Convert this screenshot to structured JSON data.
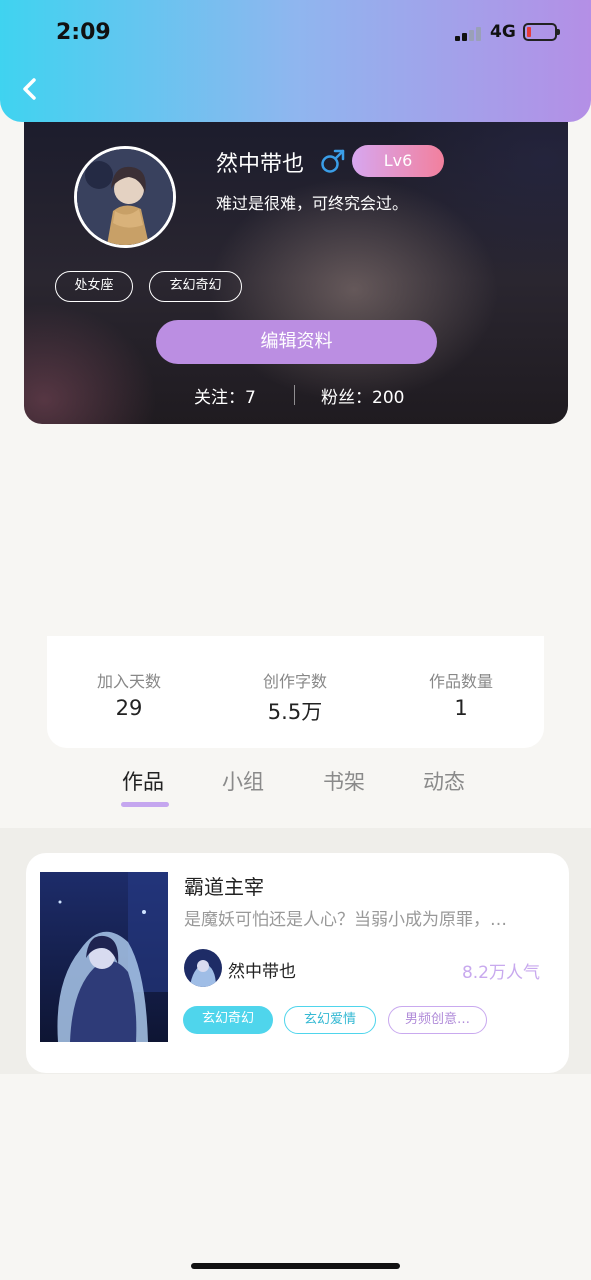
{
  "status_bar": {
    "time": "2:09",
    "network": "4G"
  },
  "profile": {
    "username": "然中带也",
    "level": "Lv6",
    "signature": "难过是很难，可终究会过。",
    "tags": [
      "处女座",
      "玄幻奇幻"
    ],
    "edit_label": "编辑资料",
    "following": "关注：7",
    "followers": "粉丝：200"
  },
  "stats": [
    {
      "label": "加入天数",
      "value": "29"
    },
    {
      "label": "创作字数",
      "value": "5.5万"
    },
    {
      "label": "作品数量",
      "value": "1"
    }
  ],
  "tabs": [
    "作品",
    "小组",
    "书架",
    "动态"
  ],
  "active_tab": "作品",
  "work": {
    "title": "霸道主宰",
    "description": "是魔妖可怕还是人心？当弱小成为原罪，…",
    "author": "然中带也",
    "popularity": "8.2万人气",
    "tags": [
      "玄幻奇幻",
      "玄幻爱情",
      "男频创意…"
    ]
  },
  "colors": {
    "header_gradient": [
      "#3fd3f0",
      "#b48fe6"
    ],
    "accent_purple": "#bb8ee2",
    "tag_cyan": "#4fd5ec",
    "tag_purple": "#c9a9ef"
  }
}
